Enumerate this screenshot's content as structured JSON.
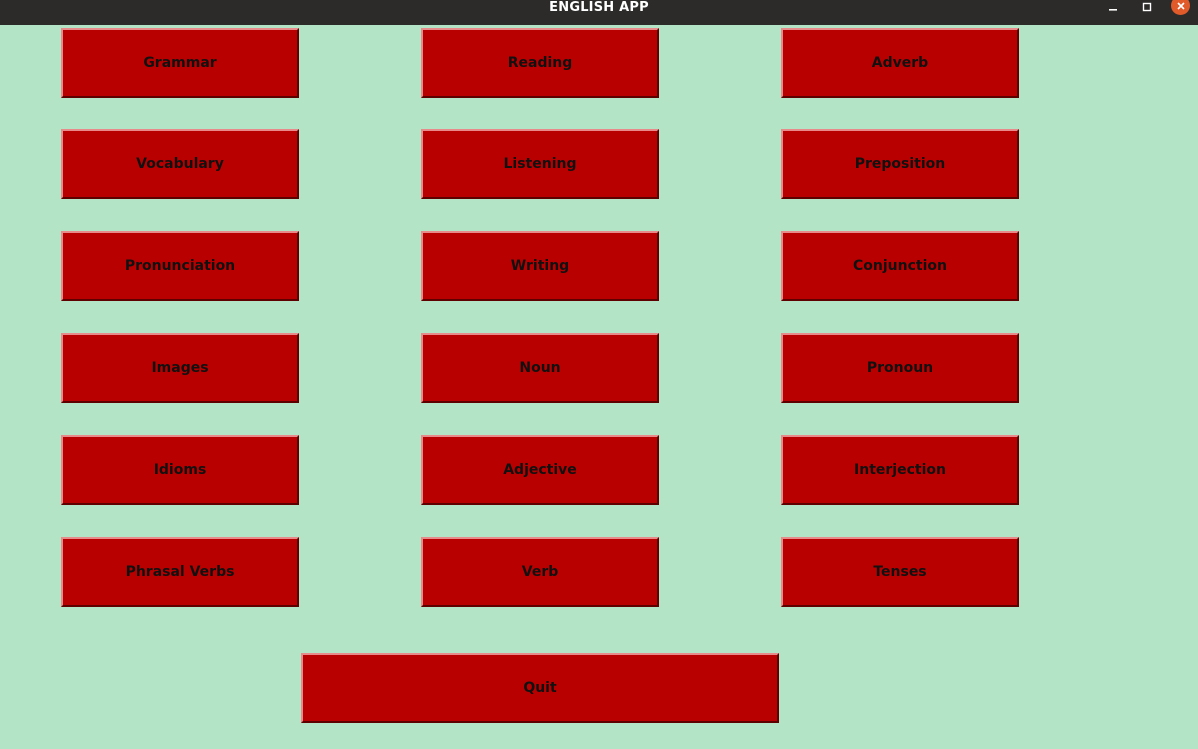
{
  "window": {
    "title": "ENGLISH APP",
    "background_color": "#b3e4c6",
    "titlebar_color": "#2c2b29"
  },
  "controls": {
    "minimize_icon": "minimize-icon",
    "maximize_icon": "maximize-icon",
    "close_icon": "close-icon",
    "close_color": "#e05a2a"
  },
  "buttons": {
    "color": "#b80000",
    "grammar": "Grammar",
    "reading": "Reading",
    "adverb": "Adverb",
    "vocabulary": "Vocabulary",
    "listening": "Listening",
    "preposition": "Preposition",
    "pronunciation": "Pronunciation",
    "writing": "Writing",
    "conjunction": "Conjunction",
    "images": "Images",
    "noun": "Noun",
    "pronoun": "Pronoun",
    "idioms": "Idioms",
    "adjective": "Adjective",
    "interjection": "Interjection",
    "phrasal_verbs": "Phrasal Verbs",
    "verb": "Verb",
    "tenses": "Tenses",
    "quit": "Quit"
  }
}
